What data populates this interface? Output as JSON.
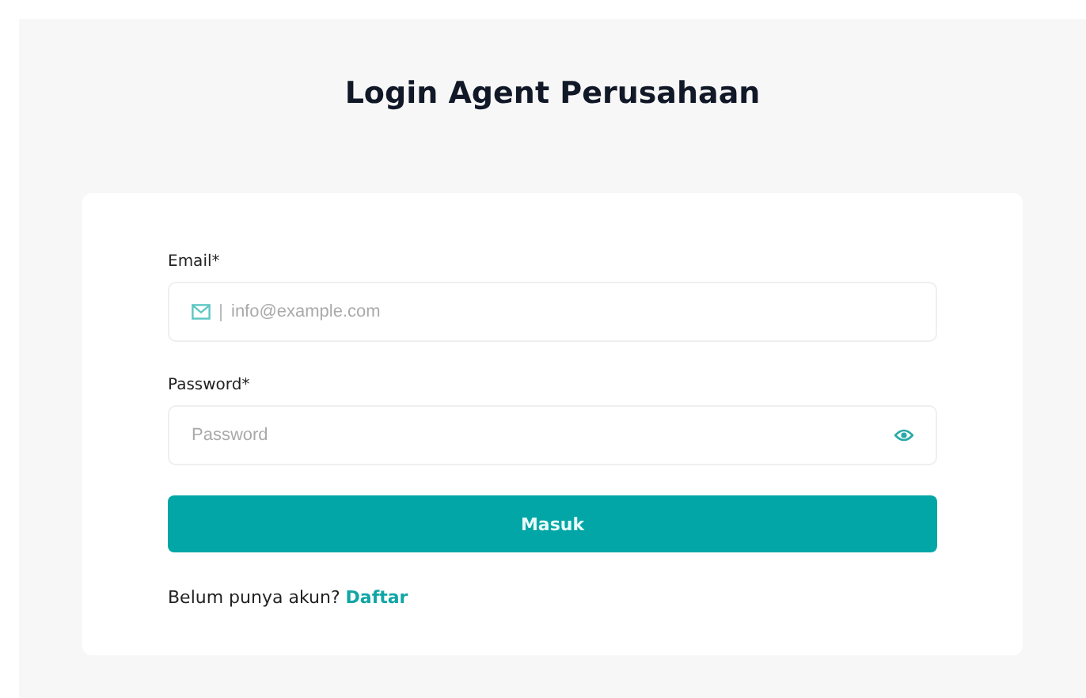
{
  "title": "Login Agent Perusahaan",
  "form": {
    "fields": [
      {
        "kind": "email",
        "label": "Email*",
        "placeholder": "info@example.com"
      },
      {
        "kind": "password",
        "label": "Password*",
        "placeholder": "Password"
      }
    ],
    "submit": "Masuk",
    "signup_prompt": "Belum punya akun?",
    "signup_link": "Daftar"
  }
}
